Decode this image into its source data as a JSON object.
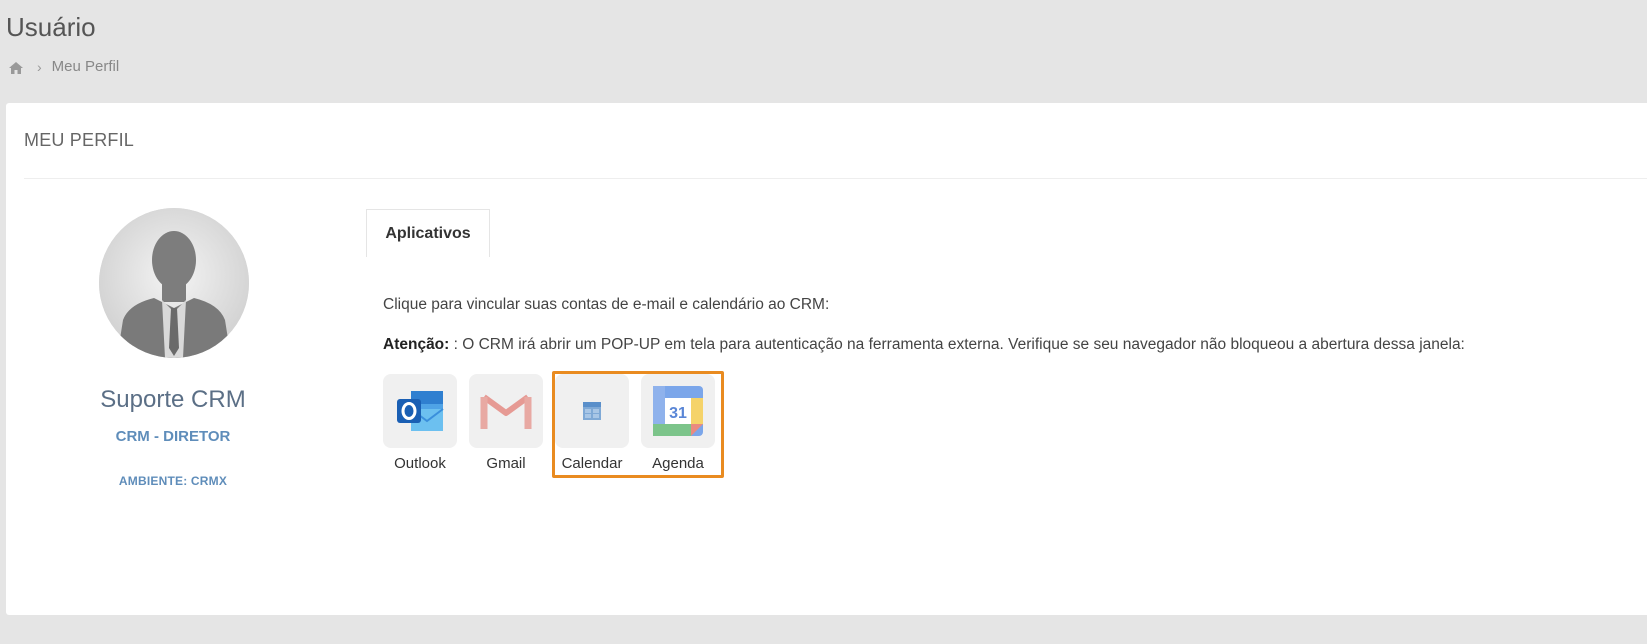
{
  "header": {
    "title": "Usuário",
    "breadcrumb": {
      "home_icon": "home-icon",
      "current": "Meu Perfil"
    }
  },
  "panel": {
    "title": "MEU PERFIL"
  },
  "profile": {
    "avatar_icon": "user-silhouette",
    "name": "Suporte CRM",
    "role": "CRM - DIRETOR",
    "environment": "AMBIENTE: CRMX"
  },
  "tabs": [
    {
      "label": "Aplicativos",
      "active": true
    }
  ],
  "content": {
    "intro": "Clique para vincular suas contas de e-mail e calendário ao CRM:",
    "attention_label": "Atenção:",
    "attention_text": " : O CRM irá abrir um POP-UP em tela para autenticação na ferramenta externa. Verifique se seu navegador não bloqueou a abertura dessa janela:"
  },
  "apps": [
    {
      "label": "Outlook",
      "icon": "outlook-icon"
    },
    {
      "label": "Gmail",
      "icon": "gmail-icon"
    },
    {
      "label": "Calendar",
      "icon": "calendar-icon"
    },
    {
      "label": "Agenda",
      "icon": "google-calendar-icon",
      "number": "31"
    }
  ],
  "colors": {
    "highlight_border": "#e98b20",
    "accent_blue": "#5f8dba",
    "name_color": "#5b6f86"
  }
}
